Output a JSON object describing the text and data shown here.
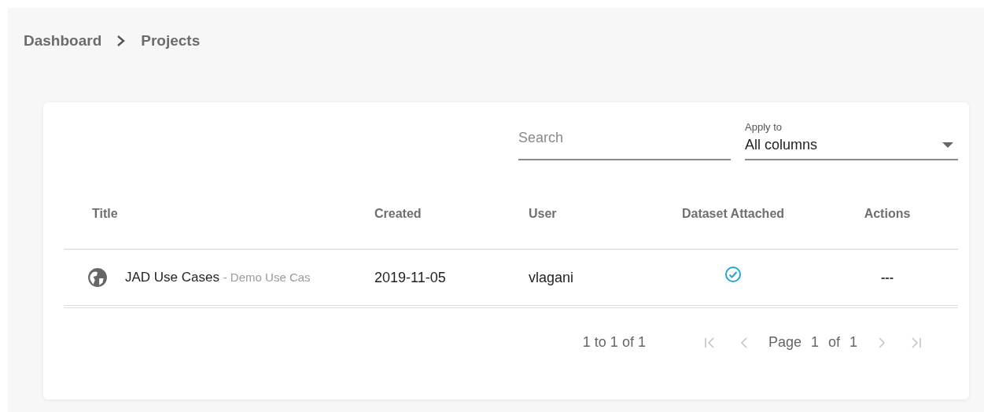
{
  "breadcrumb": [
    {
      "label": "Dashboard"
    },
    {
      "label": "Projects"
    }
  ],
  "search": {
    "placeholder": "Search"
  },
  "apply_to": {
    "label": "Apply to",
    "value": "All columns"
  },
  "table": {
    "columns": [
      {
        "label": "Title"
      },
      {
        "label": "Created"
      },
      {
        "label": "User"
      },
      {
        "label": "Dataset Attached"
      },
      {
        "label": "Actions"
      }
    ],
    "rows": [
      {
        "title": "JAD Use Cases",
        "subtitle": "- Demo Use Cas",
        "created": "2019-11-05",
        "user": "vlagani",
        "dataset_attached": true,
        "actions": "---"
      }
    ]
  },
  "pagination": {
    "summary": "1 to 1 of 1",
    "page_label": "Page",
    "page": "1",
    "of_label": "of",
    "total": "1",
    "buttons": [
      {
        "kind": "first",
        "disabled": true
      },
      {
        "kind": "prev",
        "disabled": true
      },
      {
        "kind": "next",
        "disabled": true
      },
      {
        "kind": "last",
        "disabled": true
      }
    ]
  }
}
